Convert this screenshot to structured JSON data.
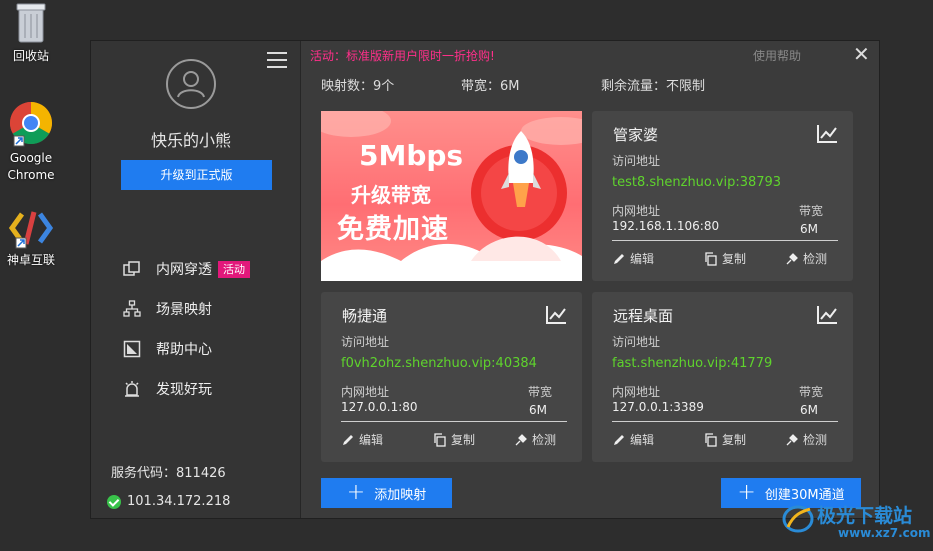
{
  "desktop": {
    "recycle_bin": "回收站",
    "chrome_line1": "Google",
    "chrome_line2": "Chrome",
    "shenzhuo": "神卓互联"
  },
  "sidebar": {
    "username": "快乐的小熊",
    "upgrade_label": "升级到正式版",
    "nav": [
      {
        "label": "内网穿透",
        "badge": "活动",
        "icon": "tunnel-icon"
      },
      {
        "label": "场景映射",
        "icon": "network-icon"
      },
      {
        "label": "帮助中心",
        "icon": "help-icon"
      },
      {
        "label": "发现好玩",
        "icon": "discover-icon"
      }
    ],
    "service_code": "服务代码：811426",
    "ip": "101.34.172.218"
  },
  "header": {
    "promo": "活动：标准版新用户限时一折抢购!",
    "help": "使用帮助",
    "close": "✕"
  },
  "stats": {
    "mappings": "映射数：9个",
    "bandwidth": "带宽：6M",
    "traffic": "剩余流量：不限制"
  },
  "banner": {
    "line1": "5Mbps",
    "line2": "升级带宽",
    "line3": "免费加速"
  },
  "labels": {
    "access": "访问地址",
    "inner": "内网地址",
    "bw": "带宽",
    "edit": "编辑",
    "copy": "复制",
    "check": "检测"
  },
  "cards": [
    {
      "title": "管家婆",
      "address": "test8.shenzhuo.vip:38793",
      "inner": "192.168.1.106:80",
      "bw": "6M"
    },
    {
      "title": "畅捷通",
      "address": "f0vh2ohz.shenzhuo.vip:40384",
      "inner": "127.0.0.1:80",
      "bw": "6M"
    },
    {
      "title": "远程桌面",
      "address": "fast.shenzhuo.vip:41779",
      "inner": "127.0.0.1:3389",
      "bw": "6M"
    }
  ],
  "buttons": {
    "add_mapping": "添加映射",
    "create_channel": "创建30M通道"
  },
  "watermark": {
    "text": "极光下载站",
    "url": "www.xz7.com"
  },
  "colors": {
    "accent": "#1f7cf0",
    "promo": "#ff2f8a",
    "address": "#5fd32d",
    "badge": "#e2187b",
    "ok": "#39c24a"
  }
}
